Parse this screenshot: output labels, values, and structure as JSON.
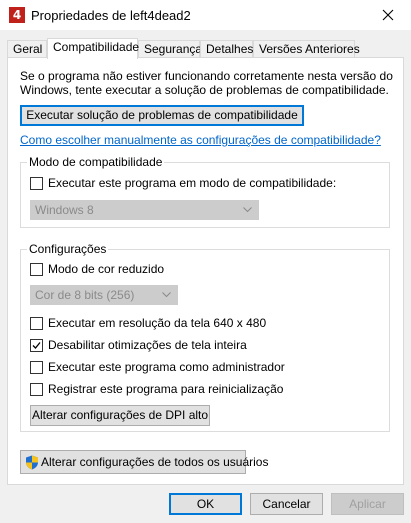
{
  "window": {
    "title": "Propriedades de left4dead2",
    "app_icon_glyph": "4",
    "icons": {
      "app": "left4dead-icon",
      "close": "close-icon"
    }
  },
  "tabs": [
    {
      "label": "Geral",
      "active": false
    },
    {
      "label": "Compatibilidade",
      "active": true
    },
    {
      "label": "Segurança",
      "active": false
    },
    {
      "label": "Detalhes",
      "active": false
    },
    {
      "label": "Versões Anteriores",
      "active": false
    }
  ],
  "compat": {
    "intro": "Se o programa não estiver funcionando corretamente nesta versão do Windows, tente executar a solução de problemas de compatibilidade.",
    "troubleshoot_button": "Executar solução de problemas de compatibilidade",
    "manual_link": "Como escolher manualmente as configurações de compatibilidade?",
    "mode_group": {
      "label": "Modo de compatibilidade",
      "run_in_mode": {
        "label": "Executar este programa em modo de compatibilidade:",
        "checked": false
      },
      "os_select": {
        "value": "Windows 8",
        "enabled": false
      }
    },
    "settings_group": {
      "label": "Configurações",
      "reduced_color": {
        "label": "Modo de cor reduzido",
        "checked": false
      },
      "color_select": {
        "value": "Cor de 8 bits (256)",
        "enabled": false
      },
      "res_640": {
        "label": "Executar em resolução da tela 640 x 480",
        "checked": false
      },
      "disable_fullscreen": {
        "label": "Desabilitar otimizações de tela inteira",
        "checked": true
      },
      "run_as_admin": {
        "label": "Executar este programa como administrador",
        "checked": false
      },
      "register_restart": {
        "label": "Registrar este programa para reinicialização",
        "checked": false
      },
      "dpi_button": "Alterar configurações de DPI alto"
    },
    "all_users_button": "Alterar configurações de todos os usuários"
  },
  "footer": {
    "ok": "OK",
    "cancel": "Cancelar",
    "apply": "Aplicar"
  },
  "colors": {
    "accent": "#0078d7",
    "link": "#0066cc",
    "brand_red": "#c0211a"
  }
}
